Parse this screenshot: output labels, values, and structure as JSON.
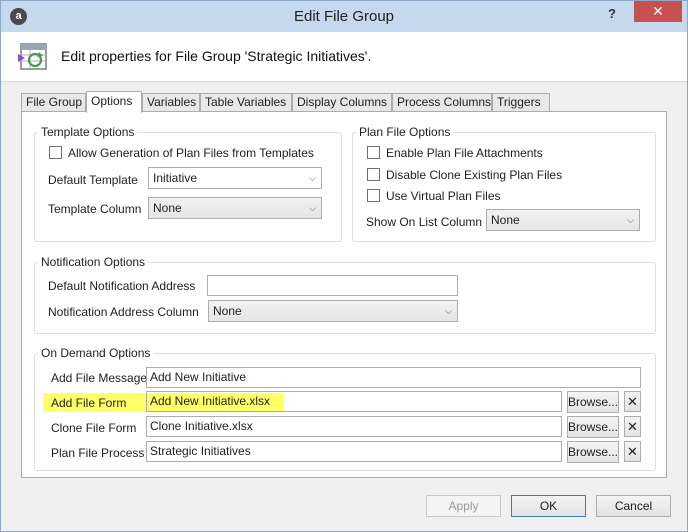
{
  "window": {
    "title": "Edit File Group",
    "app_icon_letter": "a",
    "help_glyph": "?",
    "close_glyph": "✕"
  },
  "header": {
    "text": "Edit properties for File Group 'Strategic Initiatives'."
  },
  "tabs": [
    {
      "label": "File Group",
      "active": false
    },
    {
      "label": "Options",
      "active": true
    },
    {
      "label": "Variables",
      "active": false
    },
    {
      "label": "Table Variables",
      "active": false
    },
    {
      "label": "Display Columns",
      "active": false
    },
    {
      "label": "Process Columns",
      "active": false
    },
    {
      "label": "Triggers",
      "active": false
    }
  ],
  "template_options": {
    "title": "Template Options",
    "allow_generation_label": "Allow Generation of Plan Files from Templates",
    "allow_generation_checked": false,
    "default_template_label": "Default Template",
    "default_template_value": "Initiative",
    "template_column_label": "Template Column",
    "template_column_value": "None"
  },
  "plan_file_options": {
    "title": "Plan File Options",
    "enable_attachments_label": "Enable Plan File Attachments",
    "disable_clone_label": "Disable Clone Existing Plan Files",
    "use_virtual_label": "Use Virtual Plan Files",
    "show_on_list_label": "Show On List Column",
    "show_on_list_value": "None"
  },
  "notification_options": {
    "title": "Notification Options",
    "default_address_label": "Default Notification Address",
    "default_address_value": "",
    "address_column_label": "Notification Address Column",
    "address_column_value": "None"
  },
  "on_demand_options": {
    "title": "On Demand Options",
    "add_file_message_label": "Add File Message",
    "add_file_message_value": "Add New Initiative",
    "add_file_form_label": "Add File Form",
    "add_file_form_value": "Add New Initiative.xlsx",
    "clone_file_form_label": "Clone File Form",
    "clone_file_form_value": "Clone Initiative.xlsx",
    "plan_file_process_label": "Plan File Process",
    "plan_file_process_value": "Strategic Initiatives",
    "browse_label": "Browse...",
    "clear_glyph": "✕",
    "highlight_color": "#ffff66"
  },
  "footer": {
    "apply_label": "Apply",
    "ok_label": "OK",
    "cancel_label": "Cancel"
  },
  "colors": {
    "titlebar": "#c5d8ee",
    "close_button": "#c75050",
    "default_button_border": "#3c7fb1"
  }
}
